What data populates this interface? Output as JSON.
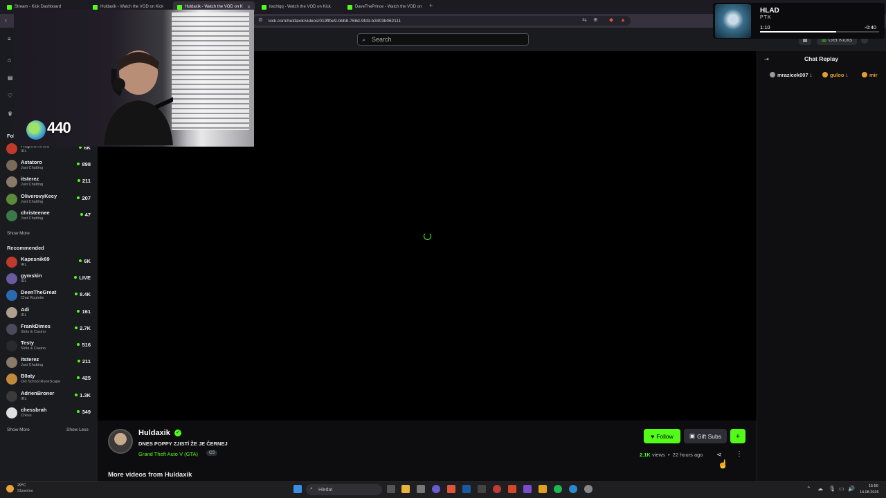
{
  "browser": {
    "tabs": [
      {
        "label": "Stream - Kick Dashboard"
      },
      {
        "label": "Huldaxik - Watch the VOD on Kick"
      },
      {
        "label": "Huldaxik - Watch the VOD on K"
      },
      {
        "label": "itachiqq - Watch the VOD on Kick"
      },
      {
        "label": "DaveThePrince - Watch the VOD on"
      }
    ],
    "url": "kick.com/huldaxik/videos/019ffbe9-bbb8-768d-9fd3-b3403b062111"
  },
  "header": {
    "search_placeholder": "Search",
    "get_kicks_label": "Get Kicks"
  },
  "sidebar": {
    "following_label": "Follo",
    "following": [
      {
        "name": "Kapesnik69",
        "category": "IRL",
        "viewers": "6K",
        "color": "#c0392b"
      },
      {
        "name": "Astatoro",
        "category": "Just Chatting",
        "viewers": "898",
        "color": "#7a6a5a"
      },
      {
        "name": "itsterez",
        "category": "Just Chatting",
        "viewers": "211",
        "color": "#8a7a6a"
      },
      {
        "name": "OliverovyKecy",
        "category": "Just Chatting",
        "viewers": "207",
        "color": "#5a8a3a"
      },
      {
        "name": "christeenee",
        "category": "Just Chatting",
        "viewers": "47",
        "color": "#3a7a4a"
      }
    ],
    "show_more_following": "Show More",
    "recommended_label": "Recommended",
    "recommended": [
      {
        "name": "Kapesnik69",
        "category": "IRL",
        "viewers": "6K",
        "color": "#c0392b"
      },
      {
        "name": "gymskin",
        "category": "IRL",
        "viewers": "LIVE",
        "color": "#6a5aa0"
      },
      {
        "name": "DeenTheGreat",
        "category": "Chat Roulette",
        "viewers": "8.4K",
        "color": "#2a6ab0"
      },
      {
        "name": "Adi",
        "category": "IRL",
        "viewers": "161",
        "color": "#b0a090"
      },
      {
        "name": "FrankDimes",
        "category": "Slots & Casino",
        "viewers": "2.7K",
        "color": "#4a4a5a"
      },
      {
        "name": "Testy",
        "category": "Slots & Casino",
        "viewers": "516",
        "color": "#2a2a2a"
      },
      {
        "name": "itsterez",
        "category": "Just Chatting",
        "viewers": "211",
        "color": "#8a7a6a"
      },
      {
        "name": "B0aty",
        "category": "Old School RuneScape",
        "viewers": "425",
        "color": "#c08a3a"
      },
      {
        "name": "AdrienBroner",
        "category": "IRL",
        "viewers": "1.3K",
        "color": "#3a3a3a"
      },
      {
        "name": "chessbrah",
        "category": "Chess",
        "viewers": "349",
        "color": "#e0e0e0"
      }
    ],
    "show_more": "Show More",
    "show_less": "Show Less"
  },
  "webcam": {
    "kicks_count": "440"
  },
  "now_playing": {
    "title": "HLAD",
    "artist": "PTK",
    "elapsed": "1:10",
    "remaining": "-0:40",
    "progress": 0.64
  },
  "chat": {
    "title": "Chat Replay",
    "users": [
      {
        "name": "mrazicek007",
        "count": "1",
        "color": "#e6e6e6",
        "badge": "#9a9a9a"
      },
      {
        "name": "guloo",
        "count": "1",
        "color": "#e0a030",
        "badge": "#e0a030"
      },
      {
        "name": "mir",
        "count": "",
        "color": "#e0a030",
        "badge": "#e0a030"
      }
    ]
  },
  "stream": {
    "streamer": "Huldaxik",
    "title": "DNES POPPY ZJISTÍ ŽE JE ČERNEJ",
    "category": "Grand Theft Auto V (GTA)",
    "language": "CS",
    "follow_label": "Follow",
    "gift_subs_label": "Gift Subs",
    "views_count": "2.1K",
    "views_word": "views",
    "time_ago": "22 hours ago",
    "more_videos": "More videos from Huldaxik"
  },
  "taskbar": {
    "weather_temp": "29°C",
    "weather_desc": "Slunečno",
    "search_placeholder": "Hledat",
    "time": "15:56",
    "date": "14.08.2026"
  },
  "colors": {
    "accent": "#53fc18",
    "background": "#0d0d0f",
    "sidebar": "#191b1f"
  }
}
